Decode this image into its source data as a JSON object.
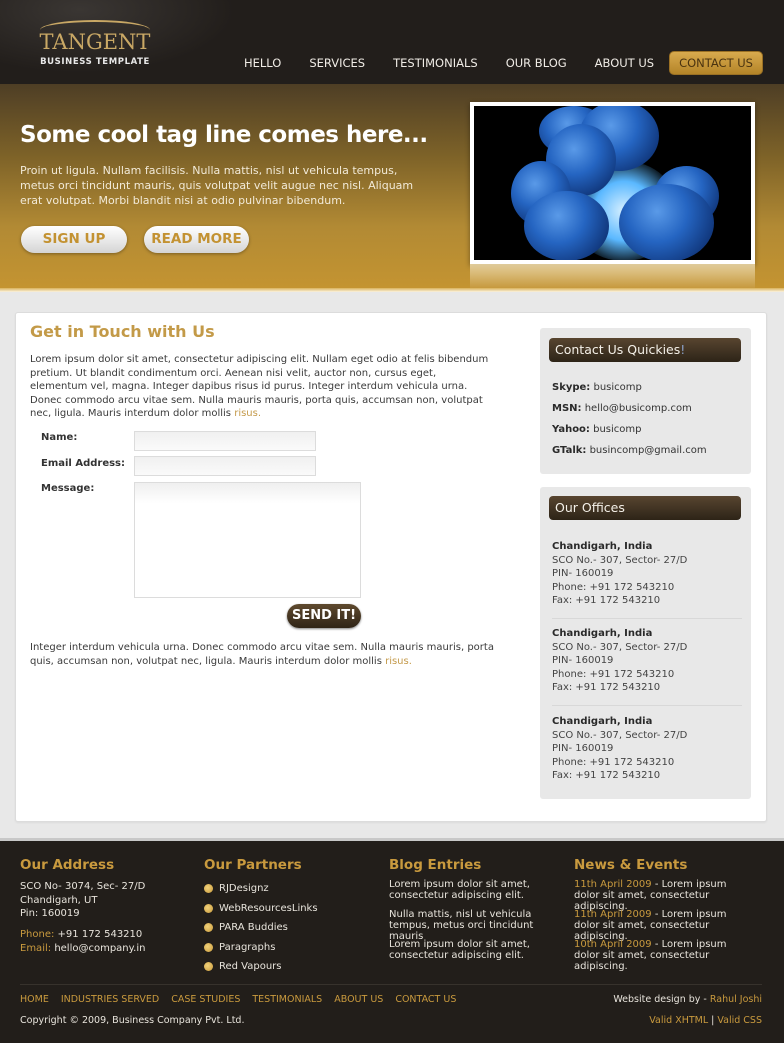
{
  "header": {
    "logo_title": "TANGENT",
    "logo_subtitle": "BUSINESS TEMPLATE",
    "nav": [
      "HELLO",
      "SERVICES",
      "TESTIMONIALS",
      "OUR BLOG",
      "ABOUT US",
      "CONTACT US"
    ],
    "active_nav": "CONTACT US"
  },
  "hero": {
    "tagline": "Some cool tag line comes here...",
    "text": "Proin ut ligula. Nullam facilisis. Nulla mattis, nisl ut vehicula tempus, metus orci tincidunt mauris, quis volutpat velit augue nec nisl. Aliquam erat volutpat. Morbi blandit nisi at odio pulvinar bibendum.",
    "signup_label": "SIGN UP",
    "readmore_label": "READ MORE",
    "image_desc": "blue-molecule-3d-render"
  },
  "main": {
    "title": "Get in Touch with Us",
    "intro": "Lorem ipsum dolor sit amet, consectetur adipiscing elit. Nullam eget odio at felis bibendum pretium. Ut blandit condimentum orci. Aenean nisi velit, auctor non, cursus eget, elementum vel, magna. Integer dapibus risus id purus. Integer interdum vehicula urna. Donec commodo arcu vitae sem. Nulla mauris mauris, porta quis, accumsan non, volutpat nec, ligula. Mauris interdum dolor mollis ",
    "intro_link": "risus.",
    "form": {
      "name_label": "Name:",
      "name_value": "",
      "email_label": "Email Address:",
      "email_value": "",
      "message_label": "Message:",
      "message_value": "",
      "send_label": "SEND IT!"
    },
    "outro": "Integer interdum vehicula urna. Donec commodo arcu vitae sem. Nulla mauris mauris, porta quis, accumsan non, volutpat nec, ligula. Mauris interdum dolor mollis ",
    "outro_link": "risus."
  },
  "sidebar": {
    "contact_title": "Contact Us Quickies",
    "contact_title_excl": "!",
    "contacts": [
      {
        "label": "Skype:",
        "value": "busicomp"
      },
      {
        "label": "MSN:",
        "value": "hello@busicomp.com"
      },
      {
        "label": "Yahoo:",
        "value": "busicomp"
      },
      {
        "label": "GTalk:",
        "value": "busincomp@gmail.com"
      }
    ],
    "offices_title": "Our Offices",
    "offices": [
      {
        "city": "Chandigarh, India",
        "address": "SCO No.- 307, Sector- 27/D",
        "pin": "PIN- 160019",
        "phone": "Phone: +91 172 543210",
        "fax": "Fax: +91 172 543210"
      },
      {
        "city": "Chandigarh, India",
        "address": "SCO No.- 307, Sector- 27/D",
        "pin": "PIN- 160019",
        "phone": "Phone: +91 172 543210",
        "fax": "Fax: +91 172 543210"
      },
      {
        "city": "Chandigarh, India",
        "address": "SCO No.- 307, Sector- 27/D",
        "pin": "PIN- 160019",
        "phone": "Phone: +91 172 543210",
        "fax": "Fax: +91 172 543210"
      }
    ]
  },
  "footer": {
    "address_title": "Our Address",
    "address_lines": [
      "SCO No- 3074, Sec- 27/D",
      "Chandigarh, UT",
      "Pin: 160019"
    ],
    "phone_label": "Phone:",
    "phone_value": "+91 172 543210",
    "email_label": "Email:",
    "email_value": "hello@company.in",
    "partners_title": "Our Partners",
    "partners": [
      "RJDesignz",
      "WebResourcesLinks",
      "PARA Buddies",
      "Paragraphs",
      "Red Vapours"
    ],
    "blog_title": "Blog Entries",
    "blog": [
      "Lorem ipsum dolor sit amet, consectetur adipiscing elit.",
      "Nulla mattis, nisl ut vehicula tempus, metus orci tincidunt mauris",
      "Lorem ipsum dolor sit amet, consectetur adipiscing elit."
    ],
    "news_title": "News & Events",
    "news": [
      {
        "date": "11th April 2009",
        "text": " - Lorem ipsum dolor sit amet, consectetur adipiscing."
      },
      {
        "date": "11th April 2009",
        "text": " - Lorem ipsum dolor sit amet, consectetur adipiscing."
      },
      {
        "date": "10th April 2009",
        "text": " - Lorem ipsum dolor sit amet, consectetur adipiscing."
      }
    ],
    "links": [
      "HOME",
      "INDUSTRIES SERVED",
      "CASE STUDIES",
      "TESTIMONIALS",
      "ABOUT US",
      "CONTACT US"
    ],
    "copyright": "Copyright © 2009, Business Company Pvt. Ltd.",
    "credit_prefix": "Website design by - ",
    "credit_name": "Rahul Joshi",
    "valid_xhtml": "Valid XHTML",
    "valid_sep": " | ",
    "valid_css": "Valid CSS"
  },
  "colors": {
    "accent_gold": "#c99a3e",
    "header_dark": "#221e1b",
    "button_brown": "#3d2f1e"
  }
}
